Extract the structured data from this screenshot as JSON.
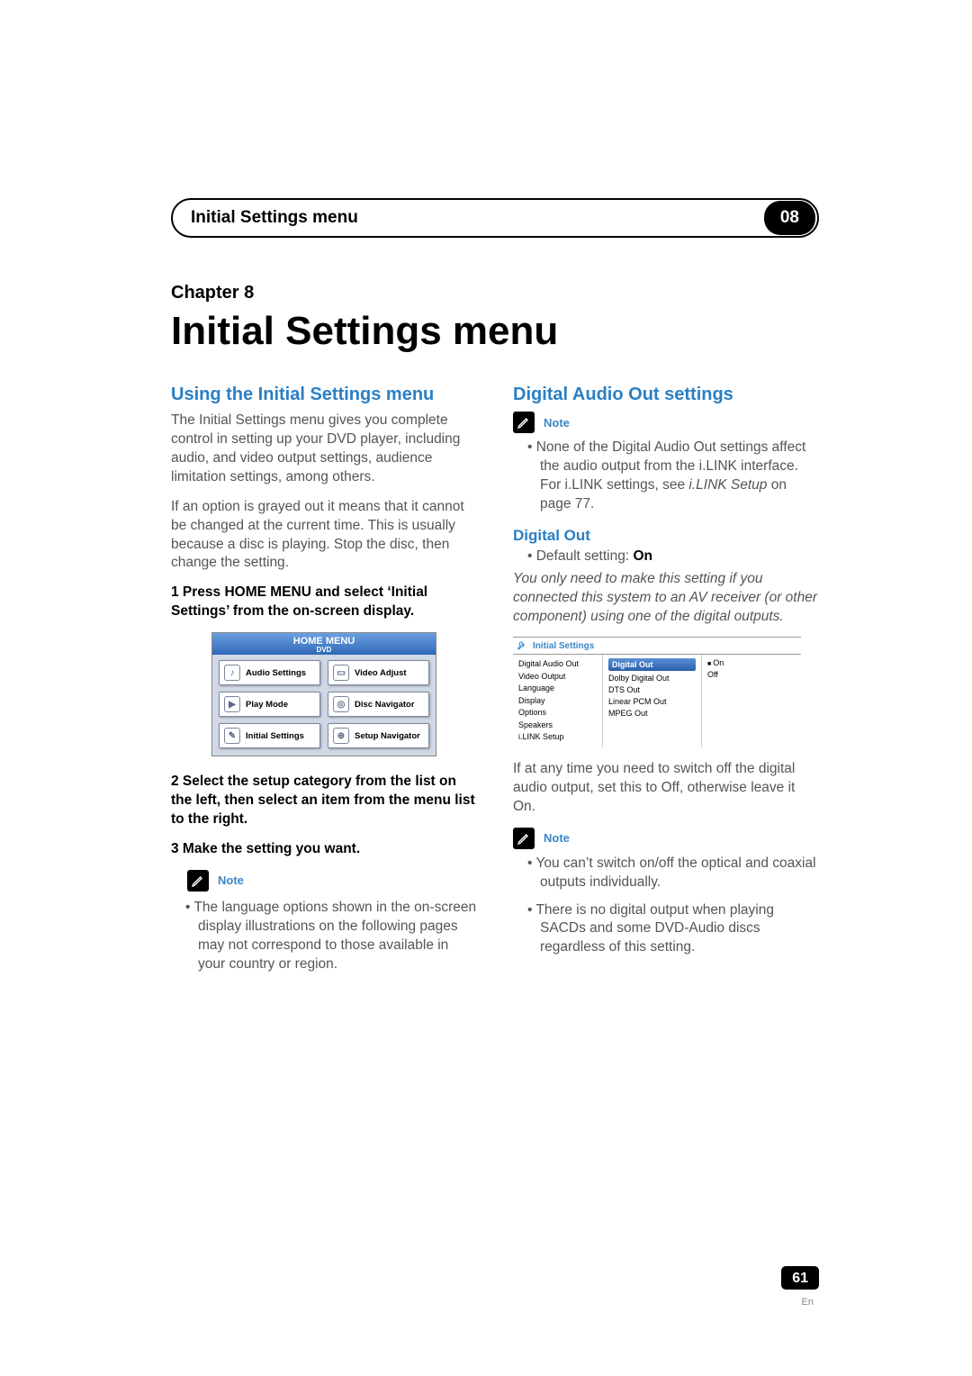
{
  "header": {
    "title": "Initial Settings menu",
    "chapter_number": "08"
  },
  "chapter": {
    "label": "Chapter 8",
    "title": "Initial Settings menu"
  },
  "left": {
    "heading": "Using the Initial Settings menu",
    "p1": "The Initial Settings menu gives you complete control in setting up your DVD player, including audio, and video output settings, audience limitation settings, among others.",
    "p2": "If an option is grayed out it means that it cannot be changed at the current time. This is usually because a disc is playing. Stop the disc, then change the setting.",
    "step1": "1    Press HOME MENU and select ‘Initial Settings’ from the on-screen display.",
    "step2": "2    Select the setup category from the list on the left, then select an item from the menu list to the right.",
    "step3": "3    Make the setting you want.",
    "note_label": "Note",
    "note_bullet": "The language options shown in the on-screen display illustrations on the following pages may not correspond to those available in your country or region."
  },
  "home_menu_fig": {
    "title": "HOME MENU",
    "subtitle": "DVD",
    "cells": [
      "Audio Settings",
      "Video Adjust",
      "Play Mode",
      "Disc Navigator",
      "Initial Settings",
      "Setup Navigator"
    ]
  },
  "right": {
    "heading": "Digital Audio Out settings",
    "note1_label": "Note",
    "note1_bullet_a": "None of the Digital Audio Out settings affect the audio output from the i.LINK interface. For i.LINK settings, see ",
    "note1_bullet_ital": "i.LINK Setup",
    "note1_bullet_b": " on page 77.",
    "sub_heading": "Digital Out",
    "default_a": "Default setting: ",
    "default_b": "On",
    "italic_para": "You only need to make this setting if you connected this system to an AV receiver (or other component) using one of the digital outputs.",
    "p_after_fig": "If at any time you need to switch off the digital audio output, set this to Off, otherwise leave it On.",
    "note2_label": "Note",
    "note2_bullet1": "You can’t switch on/off the optical and coaxial outputs individually.",
    "note2_bullet2": "There is no digital output when playing SACDs and some DVD-Audio discs regardless of this setting."
  },
  "is_fig": {
    "title": "Initial Settings",
    "col1": [
      "Digital Audio Out",
      "Video Output",
      "Language",
      "Display",
      "Options",
      "Speakers",
      "i.LINK Setup"
    ],
    "col2_head": "Digital Out",
    "col2": [
      "Dolby Digital Out",
      "DTS Out",
      "Linear PCM Out",
      "MPEG Out"
    ],
    "col3": [
      "On",
      "Off"
    ]
  },
  "page": {
    "number": "61",
    "lang": "En"
  }
}
